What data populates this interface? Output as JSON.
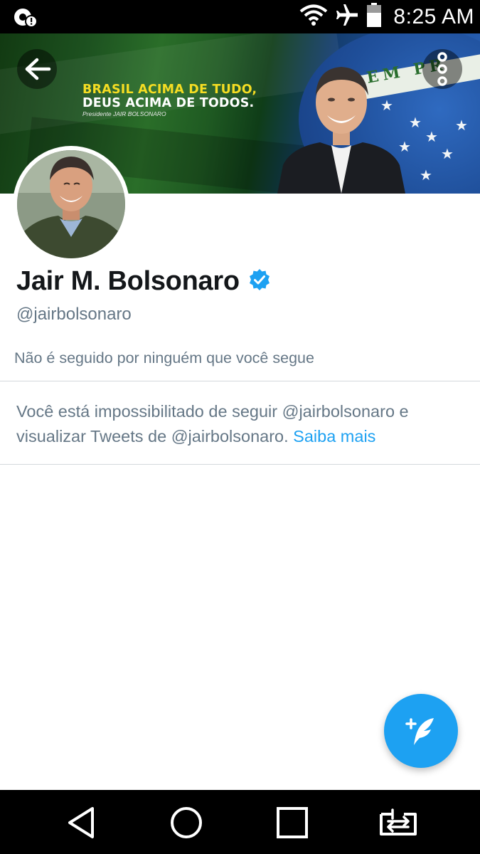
{
  "status_bar": {
    "time": "8:25 AM",
    "icons": [
      "notification-alert-icon",
      "wifi-icon",
      "airplane-mode-icon",
      "battery-icon"
    ]
  },
  "banner": {
    "line1": "BRASIL ACIMA DE TUDO,",
    "line2": "DEUS ACIMA DE TODOS.",
    "caption": "Presidente JAIR BOLSONARO",
    "motto": "EM   PR"
  },
  "header_actions": {
    "back_icon": "arrow-left-icon",
    "more_icon": "more-vertical-icon"
  },
  "profile": {
    "display_name": "Jair M. Bolsonaro",
    "verified_icon": "verified-badge-icon",
    "handle": "@jairbolsonaro",
    "followers_you_know": "Não é seguido por ninguém que você segue"
  },
  "blocked_notice": {
    "text": "Você está impossibilitado de seguir @jairbolsonaro e visualizar Tweets de @jairbolsonaro.",
    "link_label": "Saiba mais"
  },
  "fab": {
    "icon": "compose-tweet-icon"
  },
  "nav_bar": {
    "buttons": [
      "back-triangle-icon",
      "home-circle-icon",
      "recents-square-icon",
      "switch-app-icon"
    ]
  },
  "colors": {
    "accent": "#1da1f2",
    "secondary_text": "#657786",
    "primary_text": "#14171a",
    "banner_yellow": "#f5dd23"
  }
}
